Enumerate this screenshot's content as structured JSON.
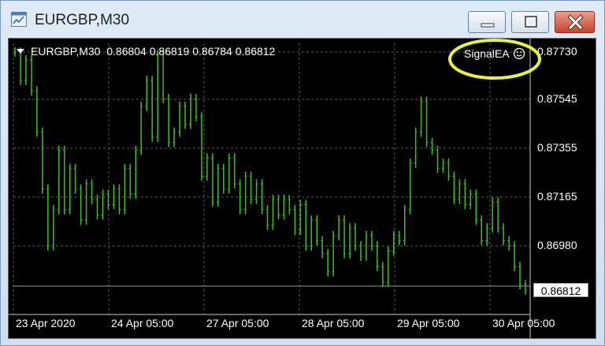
{
  "window": {
    "title": "EURGBP,M30",
    "buttons": {
      "minimize": "minimize",
      "maximize": "maximize",
      "close": "close"
    }
  },
  "chart_header": {
    "symbol_timeframe": "EURGBP,M30",
    "ohlc": [
      "0.86804",
      "0.86819",
      "0.86784",
      "0.86812"
    ],
    "expert_name": "SignalEA",
    "expert_icon": "smiley-icon"
  },
  "colors": {
    "bars": "#3fbf1f",
    "grid": "#5a5a5a",
    "background": "#000000",
    "highlight": "#e6f53a"
  },
  "current_price": "0.86812",
  "chart_data": {
    "type": "line",
    "title": "",
    "xlabel": "",
    "ylabel": "",
    "x_ticks": [
      "23 Apr 2020",
      "24 Apr 05:00",
      "27 Apr 05:00",
      "28 Apr 05:00",
      "29 Apr 05:00",
      "30 Apr 05:00"
    ],
    "y_ticks": [
      "0.87730",
      "0.87545",
      "0.87355",
      "0.87165",
      "0.86980"
    ],
    "ylim": [
      0.8676,
      0.8777
    ],
    "grid": true,
    "series": [
      {
        "values": [
          0.8773,
          0.8762,
          0.877,
          0.8758,
          0.8742,
          0.872,
          0.8698,
          0.8712,
          0.8735,
          0.8712,
          0.8728,
          0.872,
          0.8708,
          0.8722,
          0.8716,
          0.871,
          0.8718,
          0.8714,
          0.872,
          0.8712,
          0.8728,
          0.8718,
          0.8735,
          0.8752,
          0.8762,
          0.874,
          0.8772,
          0.8755,
          0.8738,
          0.8742,
          0.8752,
          0.8745,
          0.8755,
          0.8748,
          0.8725,
          0.8732,
          0.8715,
          0.8728,
          0.872,
          0.8732,
          0.8722,
          0.8712,
          0.8725,
          0.8716,
          0.8722,
          0.8712,
          0.8706,
          0.8716,
          0.871,
          0.8716,
          0.8712,
          0.8704,
          0.8714,
          0.8698,
          0.8708,
          0.87,
          0.8695,
          0.8688,
          0.8702,
          0.8708,
          0.8695,
          0.8705,
          0.8698,
          0.8694,
          0.8702,
          0.8698,
          0.869,
          0.8684,
          0.8696,
          0.8702,
          0.87,
          0.8712,
          0.873,
          0.8742,
          0.8754,
          0.8738,
          0.8735,
          0.8728,
          0.873,
          0.8725,
          0.8716,
          0.8722,
          0.8714,
          0.8718,
          0.8708,
          0.87,
          0.8705,
          0.8715,
          0.8705,
          0.87,
          0.8698,
          0.869,
          0.8683,
          0.8681
        ]
      }
    ]
  }
}
